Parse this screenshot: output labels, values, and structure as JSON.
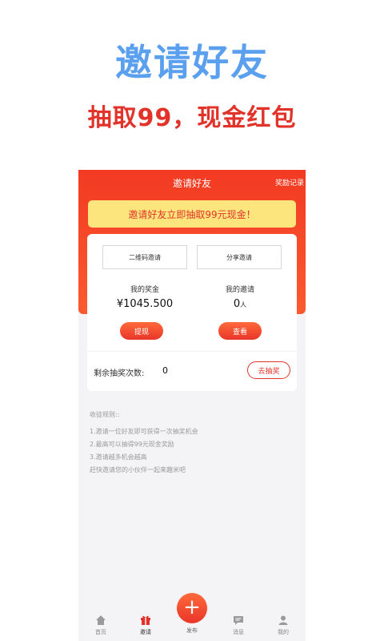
{
  "hero": {
    "title": "邀请好友",
    "subtitle": "抽取99，现金红包"
  },
  "header": {
    "title": "邀请好友",
    "reward_link": "奖励记录"
  },
  "banner": {
    "text": "邀请好友立即抽取99元现金！"
  },
  "card": {
    "qr_invite": "二维码邀请",
    "share_invite": "分享邀请",
    "bonus_label": "我的奖金",
    "bonus_value": "¥1045.500",
    "invite_label": "我的邀请",
    "invite_count": "0",
    "invite_unit": "人",
    "withdraw_btn": "提现",
    "view_btn": "查看",
    "remaining_label": "剩余抽奖次数:",
    "remaining_count": "0",
    "draw_btn": "去抽奖"
  },
  "rules": {
    "title": "收徒规则::",
    "lines": [
      "1.邀请一位好友即可获得一次抽奖机会",
      "2.最高可以抽得99元现金奖励",
      "3.邀请越多机会越高",
      "赶快邀请您的小伙伴一起来趣米吧"
    ]
  },
  "tabbar": {
    "home": "首页",
    "invite": "邀请",
    "publish": "发布",
    "messages": "消息",
    "mine": "我的"
  },
  "colors": {
    "accent": "#f23a22",
    "hero_blue": "#5aa0ee",
    "banner_yellow": "#fbe57c"
  },
  "icons": {
    "home": "home-icon",
    "invite": "gift-icon",
    "publish": "plus-icon",
    "messages": "message-icon",
    "mine": "user-icon"
  }
}
